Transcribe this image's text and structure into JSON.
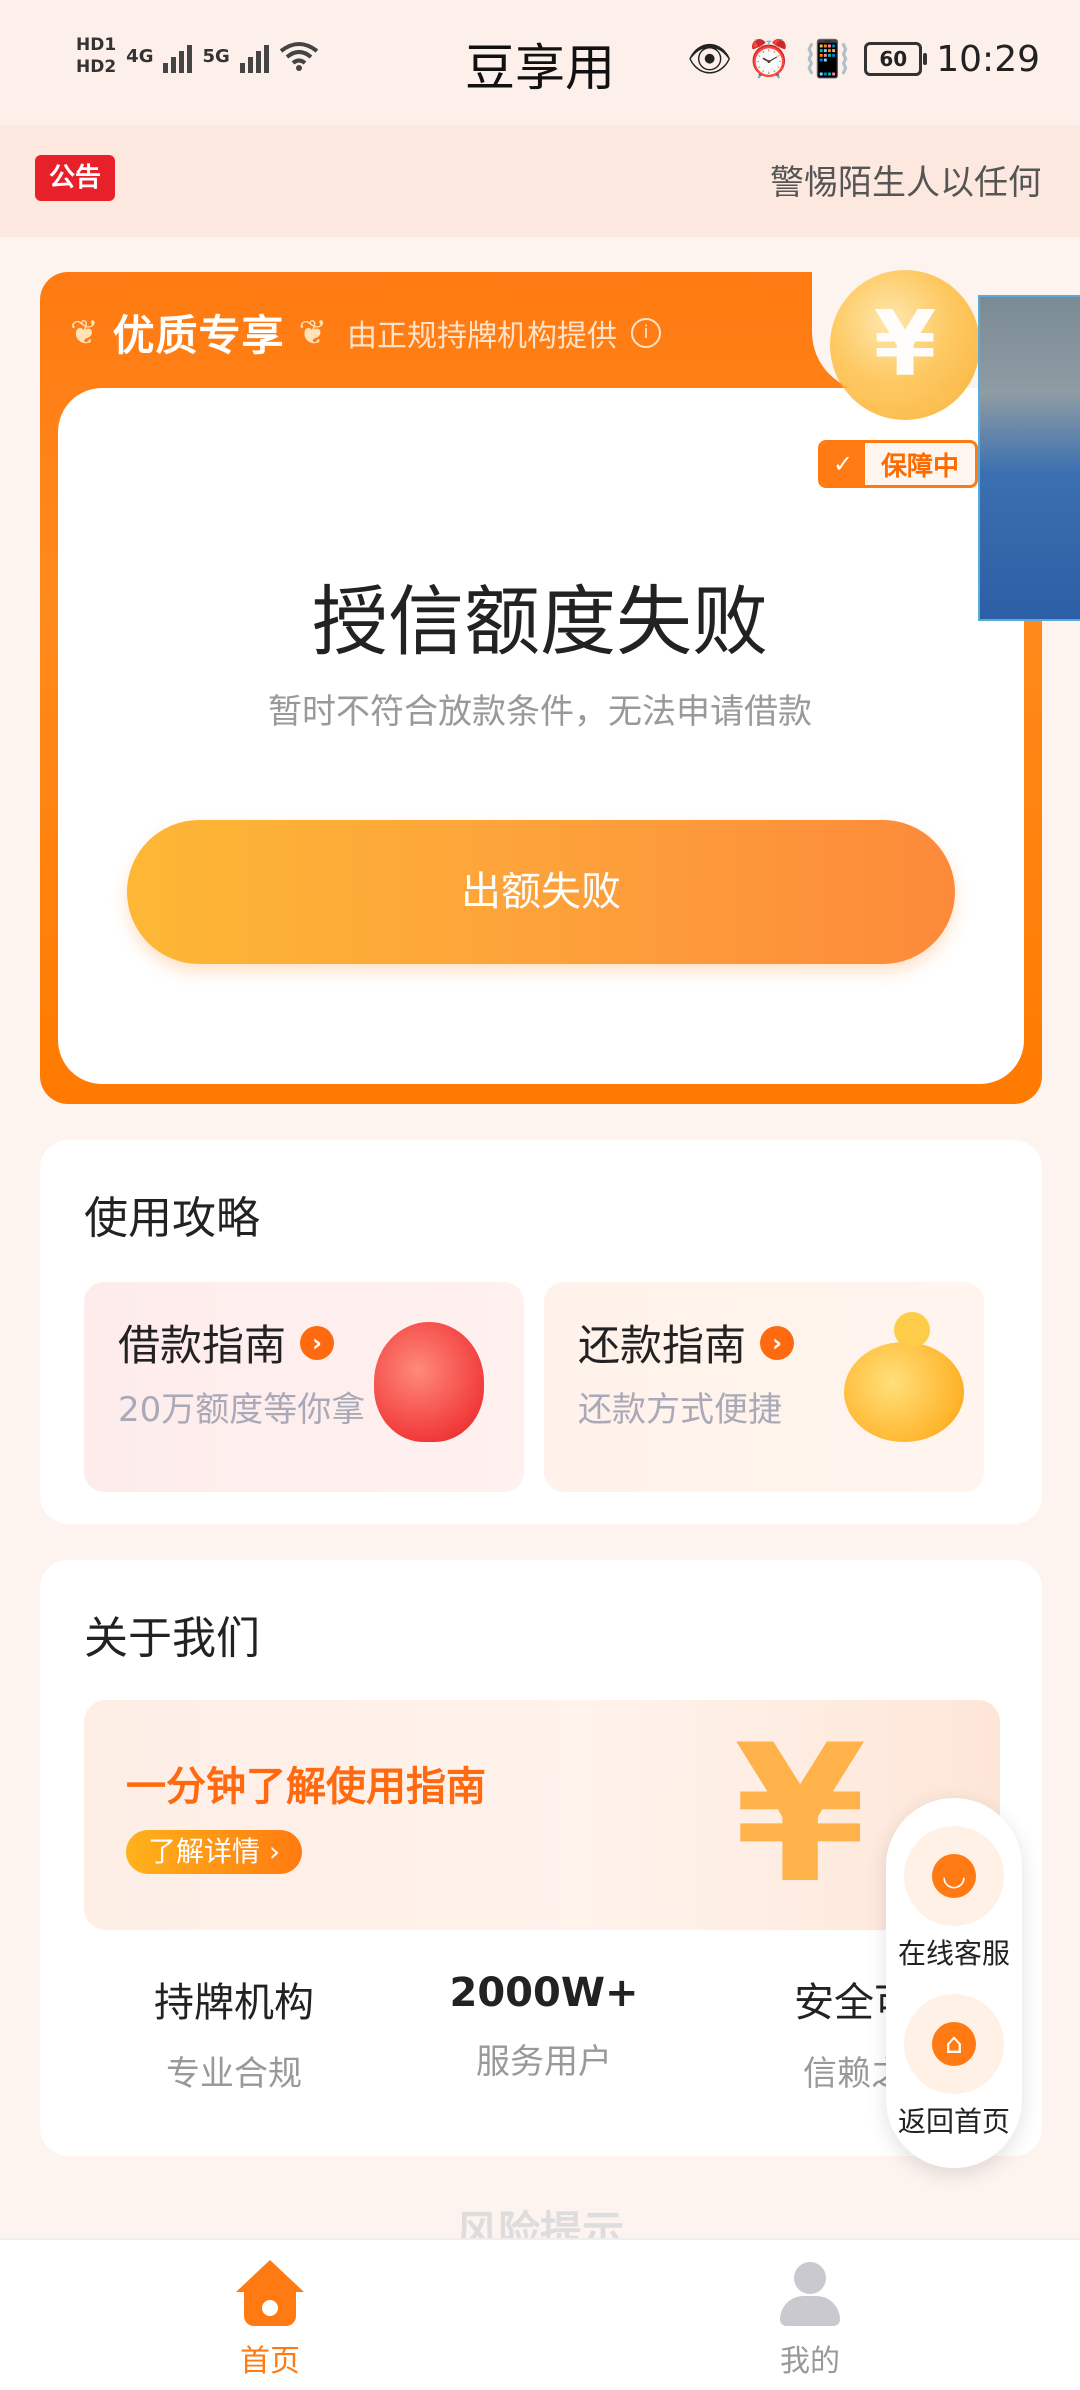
{
  "status_bar": {
    "signal_labels": [
      "HD1",
      "HD2",
      "4G",
      "5G"
    ],
    "app_title": "豆享用",
    "battery": "60",
    "time": "10:29"
  },
  "notice": {
    "tag": "公告",
    "text": "警惕陌生人以任何"
  },
  "main_card": {
    "brand": "优质专享",
    "provider_text": "由正规持牌机构提供",
    "guarantee_badge": "保障中",
    "result_title": "授信额度失败",
    "result_subtitle": "暂时不符合放款条件，无法申请借款",
    "action_button": "出额失败"
  },
  "guide": {
    "title": "使用攻略",
    "cards": [
      {
        "title": "借款指南",
        "subtitle": "20万额度等你拿"
      },
      {
        "title": "还款指南",
        "subtitle": "还款方式便捷"
      }
    ]
  },
  "about": {
    "title": "关于我们",
    "banner_title": "一分钟了解使用指南",
    "banner_button": "了解详情",
    "stats": [
      {
        "value": "持牌机构",
        "label": "专业合规"
      },
      {
        "value": "2000W+",
        "label": "服务用户"
      },
      {
        "value": "安全可",
        "label": "信赖之"
      }
    ]
  },
  "floating": {
    "service": "在线客服",
    "home": "返回首页"
  },
  "risk_hint": "风险提示",
  "bottom_nav": {
    "home": "首页",
    "mine": "我的",
    "active_color": "#ff7a12",
    "inactive_color": "#999999"
  }
}
